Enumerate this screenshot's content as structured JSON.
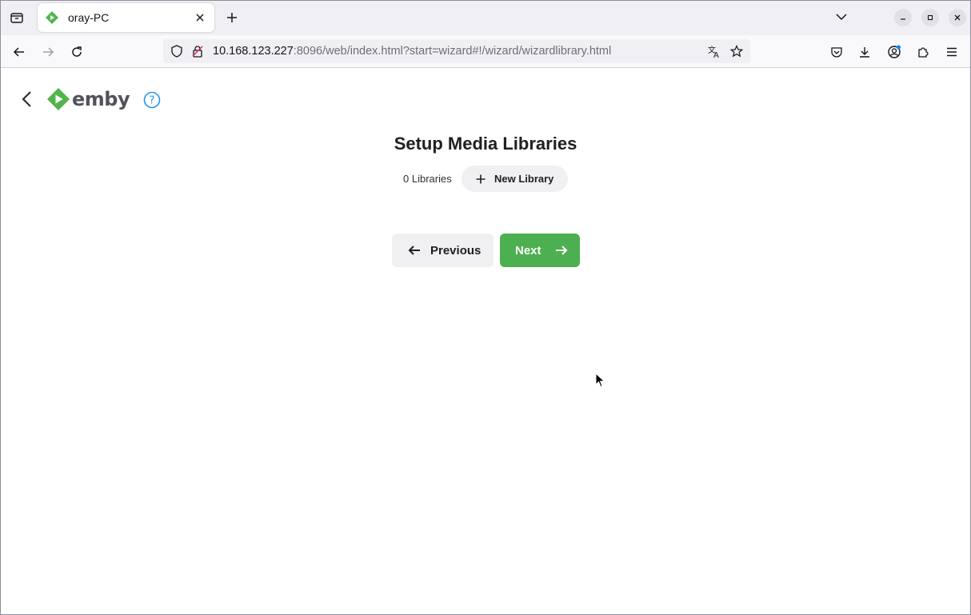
{
  "browser": {
    "tab": {
      "title": "oray-PC"
    },
    "url": {
      "host": "10.168.123.227",
      "rest": ":8096/web/index.html?start=wizard#!/wizard/wizardlibrary.html"
    }
  },
  "app": {
    "logo_text": "emby",
    "brand_color": "#52b54b"
  },
  "wizard": {
    "title": "Setup Media Libraries",
    "library_count": "0 Libraries",
    "new_library_label": "New Library",
    "previous_label": "Previous",
    "next_label": "Next"
  },
  "icons": [
    "tab-list-icon",
    "emby-favicon-icon",
    "close-icon",
    "plus-icon",
    "chevron-down-icon",
    "minimize-icon",
    "restore-icon",
    "back-arrow-icon",
    "forward-arrow-icon",
    "reload-icon",
    "shield-icon",
    "insecure-lock-icon",
    "translate-icon",
    "bookmark-star-icon",
    "pocket-icon",
    "download-icon",
    "account-icon",
    "extensions-icon",
    "menu-icon",
    "help-icon"
  ]
}
